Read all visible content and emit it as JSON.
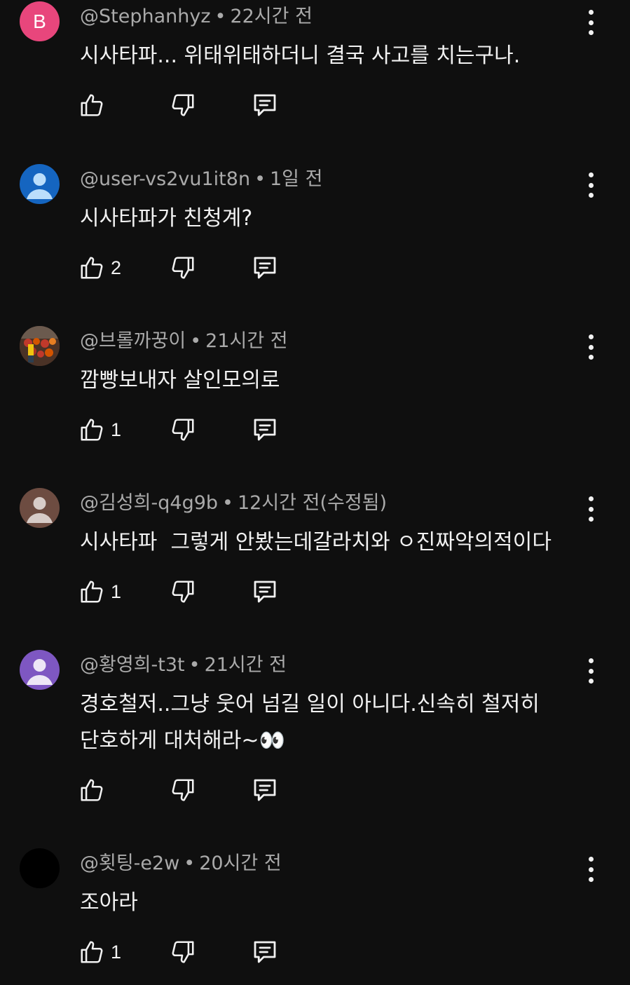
{
  "comments": [
    {
      "author": "@Stephanhyz",
      "time": "22시간 전",
      "lines": [
        "시사타파... 위태위태하더니 결국 사고를 치는구나."
      ],
      "likes": "",
      "avatar": {
        "type": "letter",
        "letter": "B",
        "color": "#e8467c"
      }
    },
    {
      "author": "@user-vs2vu1it8n",
      "time": "1일 전",
      "lines": [
        "시사타파가 친청계?"
      ],
      "likes": "2",
      "avatar": {
        "type": "default",
        "bg": "#1565c0",
        "fg": "#bbdefb"
      }
    },
    {
      "author": "@브롤까꿍이",
      "time": "21시간 전",
      "lines": [
        "깜빵보내자 살인모의로"
      ],
      "likes": "1",
      "avatar": {
        "type": "photo",
        "bg": "#5a3a2a"
      }
    },
    {
      "author": "@김성희-q4g9b",
      "time": "12시간 전(수정됨)",
      "lines": [
        "시사타파  그렇게 안봤는데갈라치와 ㅇ진짜악의적이다"
      ],
      "likes": "1",
      "avatar": {
        "type": "default",
        "bg": "#6d4c41",
        "fg": "#d7ccc8"
      }
    },
    {
      "author": "@황영희-t3t",
      "time": "21시간 전",
      "lines": [
        "경호철저..그냥 웃어 넘길 일이 아니다.신속히 철저히",
        "단호하게 대처해라~👀"
      ],
      "likes": "",
      "avatar": {
        "type": "default",
        "bg": "#7e57c2",
        "fg": "#ede7f6"
      }
    },
    {
      "author": "@횟팅-e2w",
      "time": "20시간 전",
      "lines": [
        "조아라"
      ],
      "likes": "1",
      "avatar": {
        "type": "solid",
        "bg": "#000000"
      }
    }
  ]
}
